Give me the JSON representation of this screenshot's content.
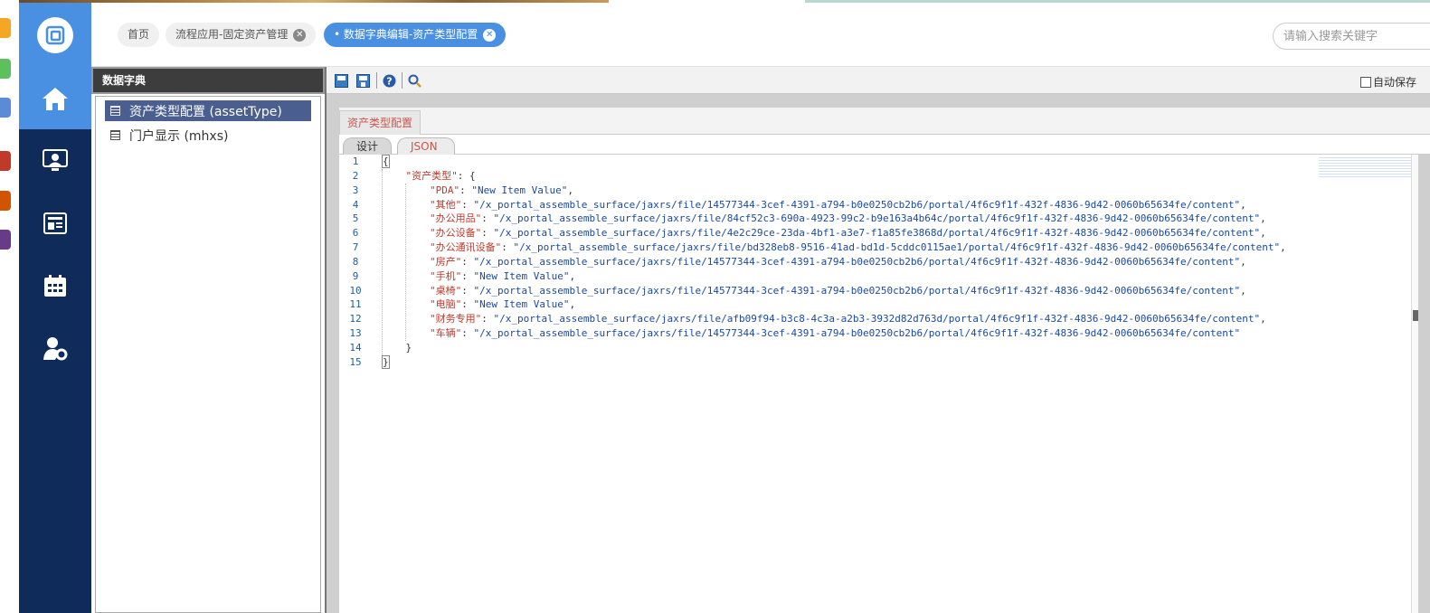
{
  "tabs": [
    {
      "label": "首页",
      "closable": false
    },
    {
      "label": "流程应用-固定资产管理",
      "closable": true
    },
    {
      "label": "数据字典编辑-资产类型配置",
      "closable": true,
      "active": true
    }
  ],
  "search": {
    "placeholder": "请输入搜索关键字"
  },
  "nav": {
    "items": [
      {
        "icon": "home-icon",
        "active": true
      },
      {
        "icon": "user-screen-icon"
      },
      {
        "icon": "newspaper-icon"
      },
      {
        "icon": "calendar-icon"
      },
      {
        "icon": "user-settings-icon"
      }
    ]
  },
  "dictionary": {
    "title": "数据字典",
    "items": [
      {
        "label": "资产类型配置 (assetType)",
        "selected": true
      },
      {
        "label": "门户显示 (mhxs)"
      }
    ]
  },
  "toolbar": {
    "autosave_label": "自动保存"
  },
  "form": {
    "tab_label": "资产类型配置",
    "subtabs": [
      "设计",
      "JSON"
    ]
  },
  "code": {
    "line_numbers": [
      "1",
      "2",
      "3",
      "4",
      "5",
      "6",
      "7",
      "8",
      "9",
      "10",
      "11",
      "12",
      "13",
      "14",
      "15"
    ],
    "root_key": "资产类型",
    "entries": [
      {
        "key": "PDA",
        "value": "New Item Value"
      },
      {
        "key": "其他",
        "value": "/x_portal_assemble_surface/jaxrs/file/14577344-3cef-4391-a794-b0e0250cb2b6/portal/4f6c9f1f-432f-4836-9d42-0060b65634fe/content"
      },
      {
        "key": "办公用品",
        "value": "/x_portal_assemble_surface/jaxrs/file/84cf52c3-690a-4923-99c2-b9e163a4b64c/portal/4f6c9f1f-432f-4836-9d42-0060b65634fe/content"
      },
      {
        "key": "办公设备",
        "value": "/x_portal_assemble_surface/jaxrs/file/4e2c29ce-23da-4bf1-a3e7-f1a85fe3868d/portal/4f6c9f1f-432f-4836-9d42-0060b65634fe/content"
      },
      {
        "key": "办公通讯设备",
        "value": "/x_portal_assemble_surface/jaxrs/file/bd328eb8-9516-41ad-bd1d-5cddc0115ae1/portal/4f6c9f1f-432f-4836-9d42-0060b65634fe/content"
      },
      {
        "key": "房产",
        "value": "/x_portal_assemble_surface/jaxrs/file/14577344-3cef-4391-a794-b0e0250cb2b6/portal/4f6c9f1f-432f-4836-9d42-0060b65634fe/content"
      },
      {
        "key": "手机",
        "value": "New Item Value"
      },
      {
        "key": "桌椅",
        "value": "/x_portal_assemble_surface/jaxrs/file/14577344-3cef-4391-a794-b0e0250cb2b6/portal/4f6c9f1f-432f-4836-9d42-0060b65634fe/content"
      },
      {
        "key": "电脑",
        "value": "New Item Value"
      },
      {
        "key": "财务专用",
        "value": "/x_portal_assemble_surface/jaxrs/file/afb09f94-b3c8-4c3a-a2b3-3932d82d763d/portal/4f6c9f1f-432f-4836-9d42-0060b65634fe/content"
      },
      {
        "key": "车辆",
        "value": "/x_portal_assemble_surface/jaxrs/file/14577344-3cef-4391-a794-b0e0250cb2b6/portal/4f6c9f1f-432f-4836-9d42-0060b65634fe/content"
      }
    ]
  },
  "colors": {
    "nav_bg": "#0f2b59",
    "accent": "#4a90e2",
    "json_key": "#c0392b",
    "json_string": "#1a4aa0"
  }
}
